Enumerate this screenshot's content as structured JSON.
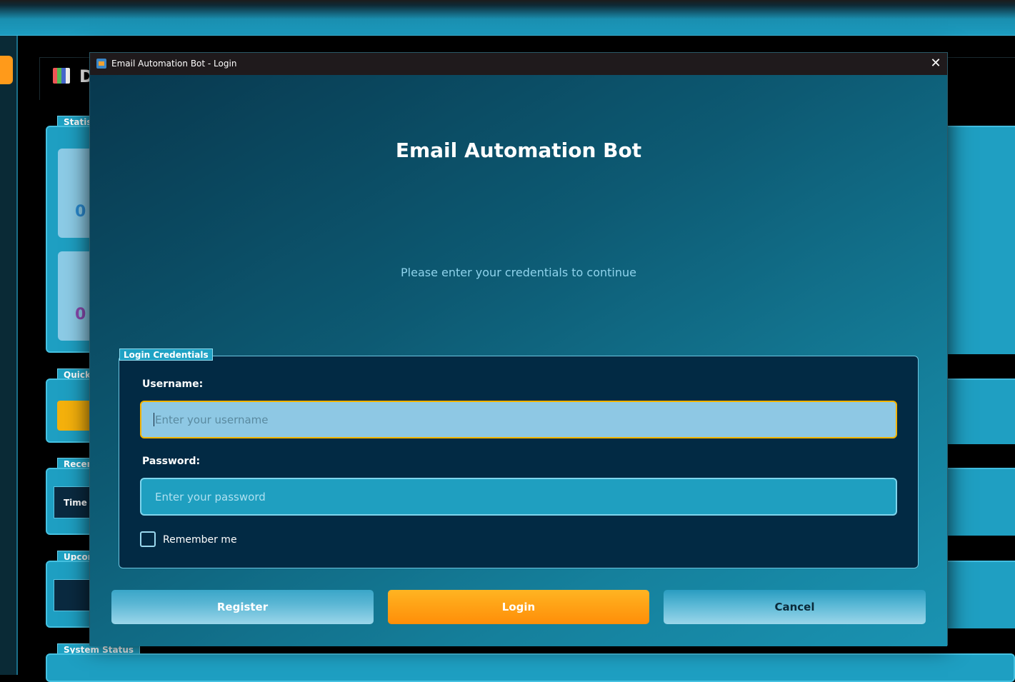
{
  "background": {
    "title_partial": "D",
    "legends": {
      "statistics": "Statisti",
      "quick": "Quick A",
      "recent": "Recent",
      "upcoming": "Upcom",
      "system_status": "System Status"
    },
    "stat_values": [
      "0",
      "0"
    ],
    "table_header_time": "Time"
  },
  "dialog": {
    "window_title": "Email Automation Bot - Login",
    "close_glyph": "✕",
    "heading": "Email Automation Bot",
    "subheading": "Please enter your credentials to continue",
    "group_title": "Login Credentials",
    "username": {
      "label": "Username:",
      "placeholder": "Enter your username",
      "value": ""
    },
    "password": {
      "label": "Password:",
      "placeholder": "Enter your password",
      "value": ""
    },
    "remember_me": {
      "label": "Remember me",
      "checked": false
    },
    "buttons": {
      "register": "Register",
      "login": "Login",
      "cancel": "Cancel"
    }
  },
  "colors": {
    "accent_orange": "#ff9a10",
    "focus_border": "#f4b400",
    "panel_blue": "#1e9fc2",
    "dark_navy": "#022a44"
  },
  "icons": {
    "window_icon": "app-icon",
    "close": "close-icon",
    "background_logo": "dashboard-logo-icon"
  }
}
